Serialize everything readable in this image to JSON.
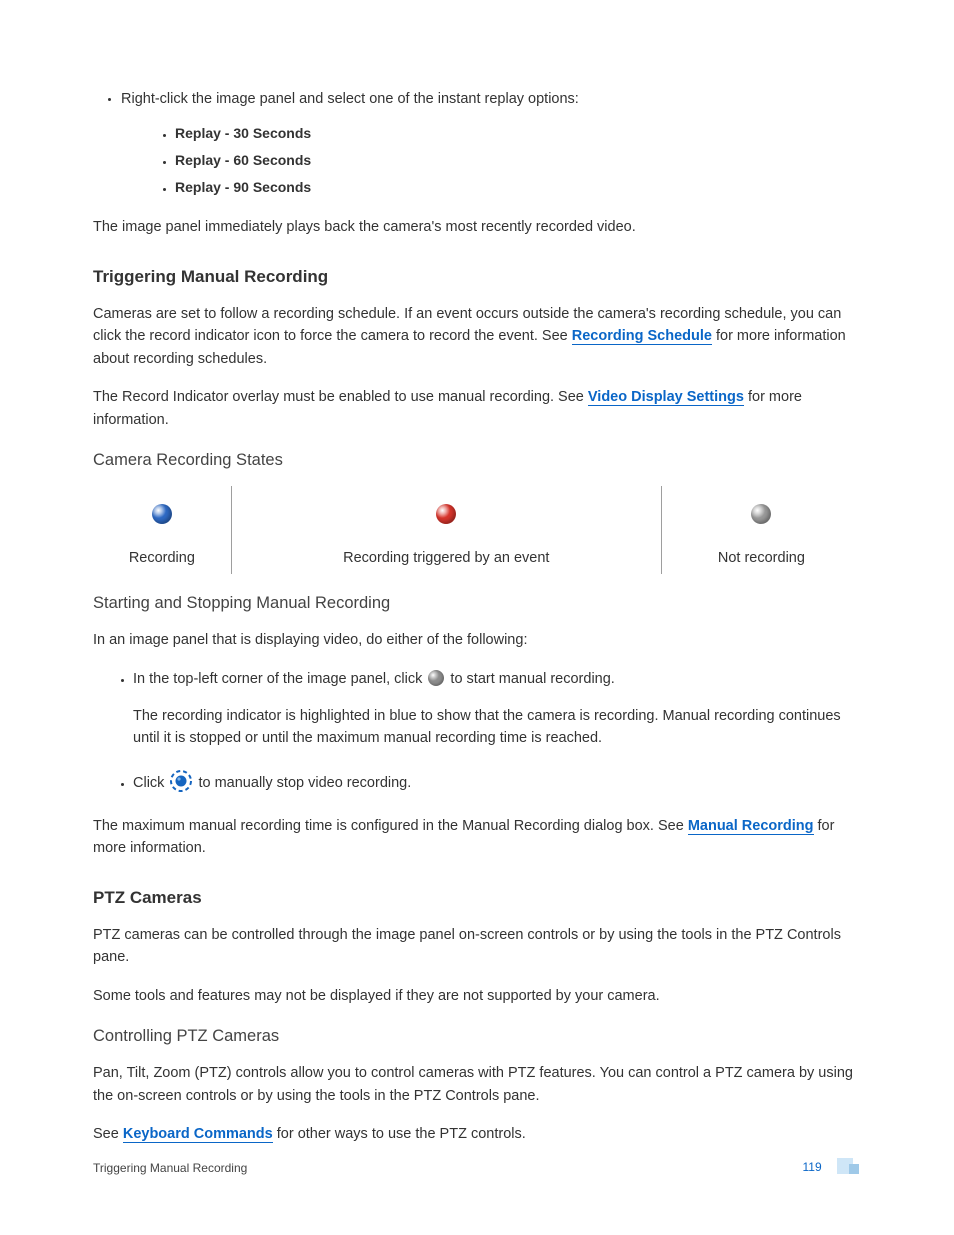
{
  "intro": {
    "line": "Right-click the image panel and select one of the instant replay options:",
    "options": [
      "Replay - 30 Seconds",
      "Replay - 60 Seconds",
      "Replay - 90 Seconds"
    ],
    "after": "The image panel immediately plays back the camera's most recently recorded video."
  },
  "triggering": {
    "heading": "Triggering Manual Recording",
    "p1a": "Cameras are set to follow a recording schedule. If an event occurs outside the camera's recording schedule, you can click the record indicator icon to force the camera to record the event. See ",
    "link1": "Recording Schedule",
    "p1b": " for more information about recording schedules.",
    "p2a": "The Record Indicator overlay must be enabled to use manual recording. See ",
    "link2": "Video Display Settings",
    "p2b": " for more information."
  },
  "states": {
    "heading": "Camera Recording States",
    "labels": [
      "Recording",
      "Recording triggered by an event",
      "Not recording"
    ]
  },
  "startstop": {
    "heading": "Starting and Stopping Manual Recording",
    "lead": "In an image panel that is displaying video, do either of the following:",
    "s1a": "In the top-left corner of the image panel, click ",
    "s1b": " to start manual recording.",
    "s1note": "The recording indicator is highlighted in blue to show that the camera is recording. Manual recording continues until it is stopped or until the maximum manual recording time is reached.",
    "s2a": "Click ",
    "s2b": " to manually stop video recording.",
    "maxa": "The maximum manual recording time is configured in the Manual Recording dialog box. See ",
    "maxlink": "Manual Recording",
    "maxb": " for more information."
  },
  "ptz": {
    "heading": "PTZ Cameras",
    "p1": "PTZ cameras can be controlled through the image panel on-screen controls or by using the tools in the PTZ Controls pane.",
    "p2": "Some tools and features may not be displayed if they are not supported by your camera.",
    "sub": "Controlling PTZ Cameras",
    "p3": "Pan, Tilt, Zoom (PTZ) controls allow you to control cameras with PTZ features. You can control a PTZ camera by using the on-screen controls or by using the tools in the PTZ Controls pane.",
    "p4a": "See ",
    "p4link": "Keyboard Commands",
    "p4b": " for other ways to use the PTZ controls."
  },
  "footer": {
    "left": "Triggering Manual Recording",
    "page": "119"
  }
}
